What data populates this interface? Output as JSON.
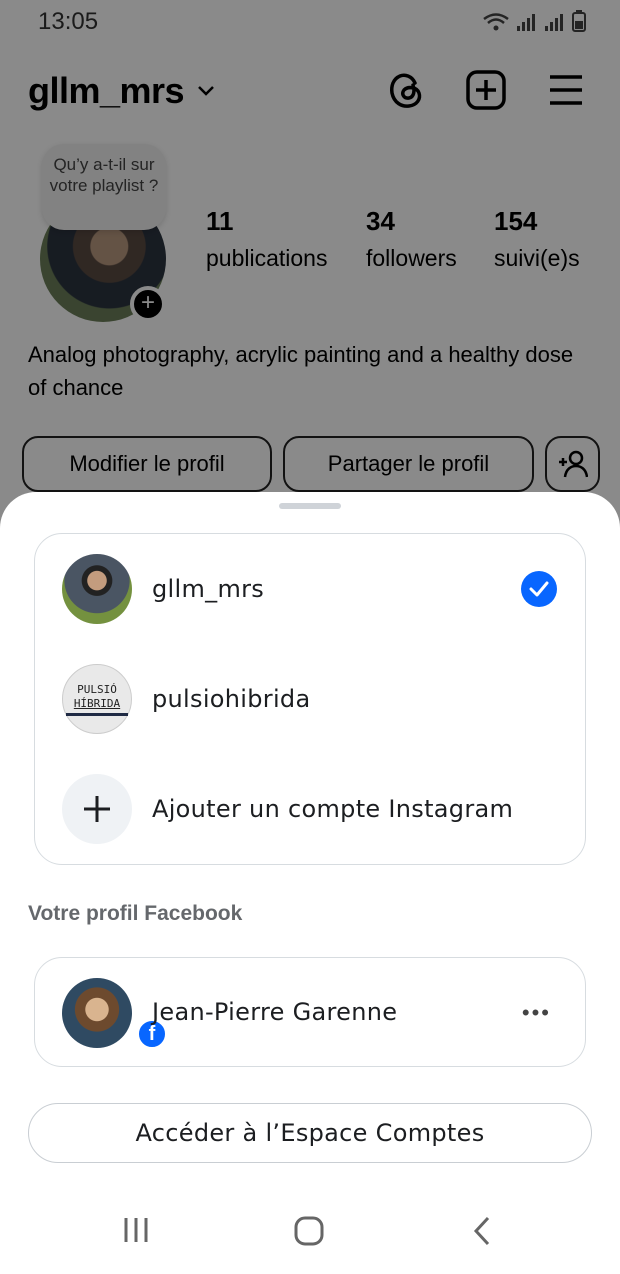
{
  "status_bar": {
    "time": "13:05"
  },
  "profile": {
    "username": "gllm_mrs",
    "note": "Qu’y a-t-il sur votre playlist ?",
    "stats": [
      {
        "value": "11",
        "label": "publications"
      },
      {
        "value": "34",
        "label": "followers"
      },
      {
        "value": "154",
        "label": "suivi(e)s"
      }
    ],
    "bio": "Analog photography, acrylic painting and a healthy dose of chance",
    "edit_button": "Modifier le profil",
    "share_button": "Partager le profil"
  },
  "sheet": {
    "accounts": [
      {
        "name": "gllm_mrs",
        "selected": true
      },
      {
        "name": "pulsiohibrida",
        "selected": false,
        "logo_text_1": "PULSIÓ",
        "logo_text_2": "HÍBRIDA"
      }
    ],
    "add_account": "Ajouter un compte Instagram",
    "facebook_section_label": "Votre profil Facebook",
    "facebook_profile": "Jean-Pierre Garenne",
    "account_center_button": "Accéder à l’Espace Comptes"
  },
  "colors": {
    "accent_blue": "#0866ff",
    "overlay": "rgba(0,0,0,0.46)"
  }
}
